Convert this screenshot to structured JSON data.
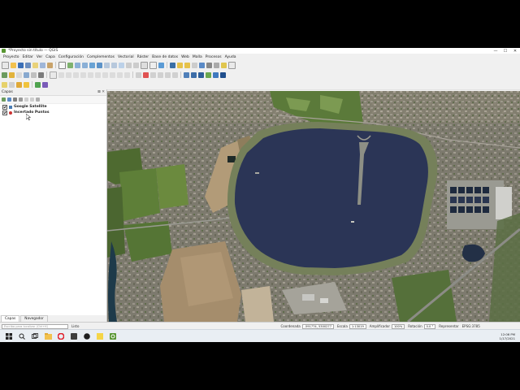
{
  "window": {
    "title": "*Proyecto sin título — QGIS",
    "buttons": [
      "—",
      "☐",
      "✕"
    ]
  },
  "menu": [
    "Proyecto",
    "Editar",
    "Ver",
    "Capa",
    "Configuración",
    "Complementos",
    "Vectorial",
    "Ráster",
    "Base de datos",
    "Web",
    "Malla",
    "Procesos",
    "Ayuda"
  ],
  "layers_panel": {
    "title": "Capas",
    "controls": "⊠ ✕",
    "layers": [
      {
        "name": "Google Satellite",
        "checked": true,
        "icon_color": "#4a7db5"
      },
      {
        "name": "Incertado Puntos",
        "checked": true,
        "icon_color": "#cc3333"
      }
    ]
  },
  "bottom_tabs": [
    "Capas",
    "Navegador"
  ],
  "statusbar": {
    "search_placeholder": "Escriba para localizar (Ctrl+K)",
    "ready": "Listo",
    "coord_label": "Coordenada",
    "coord_value": "-591774, 5300277",
    "scale_label": "Escala",
    "scale_value": "1:13019",
    "magnifier_label": "Amplificador",
    "magnifier_value": "100%",
    "rotation_label": "Rotación",
    "rotation_value": "0.0 °",
    "render_label": "Representar",
    "crs": "EPSG:3785"
  },
  "taskbar": {
    "search_icon": "search-icon",
    "time": "12:06 PM",
    "date": "1/17/2021"
  },
  "map": {
    "basemap": "Google Satellite",
    "water_color": "#2b3556"
  }
}
